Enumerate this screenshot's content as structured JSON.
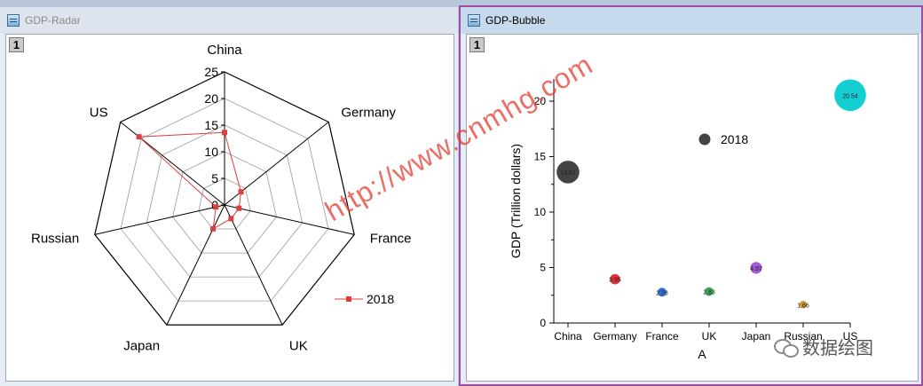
{
  "windows": {
    "left": {
      "title": "GDP-Radar",
      "layer": "1"
    },
    "right": {
      "title": "GDP-Bubble",
      "layer": "1"
    }
  },
  "watermark": "http://www.cnmhg.com",
  "badge": {
    "icon": "wechat-icon",
    "text": "数据绘图"
  },
  "chart_data": [
    {
      "type": "radar",
      "categories": [
        "China",
        "Germany",
        "France",
        "UK",
        "Japan",
        "Russian",
        "US"
      ],
      "r_ticks": [
        0,
        5,
        10,
        15,
        20,
        25
      ],
      "rlim": [
        0,
        25
      ],
      "series": [
        {
          "name": "2018",
          "values": [
            13.61,
            3.95,
            2.78,
            2.83,
            4.97,
            1.66,
            20.54
          ],
          "color": "#d94040"
        }
      ],
      "legend": "right"
    },
    {
      "type": "scatter",
      "categories": [
        "China",
        "Germany",
        "France",
        "UK",
        "Japan",
        "Russian",
        "US"
      ],
      "values": [
        13.61,
        3.95,
        2.78,
        2.83,
        4.97,
        1.66,
        20.54
      ],
      "labels": [
        "13.61",
        "3.95",
        "2.78",
        "2.83",
        "4.97",
        "1.66",
        "20.54"
      ],
      "colors": [
        "#444444",
        "#e2323c",
        "#2f6fd0",
        "#3ca95a",
        "#a15bd6",
        "#c99a2e",
        "#14cfd2"
      ],
      "xlabel": "A",
      "ylabel": "GDP (Trillion dollars)",
      "ylim": [
        0,
        22
      ],
      "y_ticks": [
        0,
        5,
        10,
        15,
        20
      ],
      "legend_label": "2018",
      "legend_color": "#444444",
      "legend": "top-right"
    }
  ]
}
